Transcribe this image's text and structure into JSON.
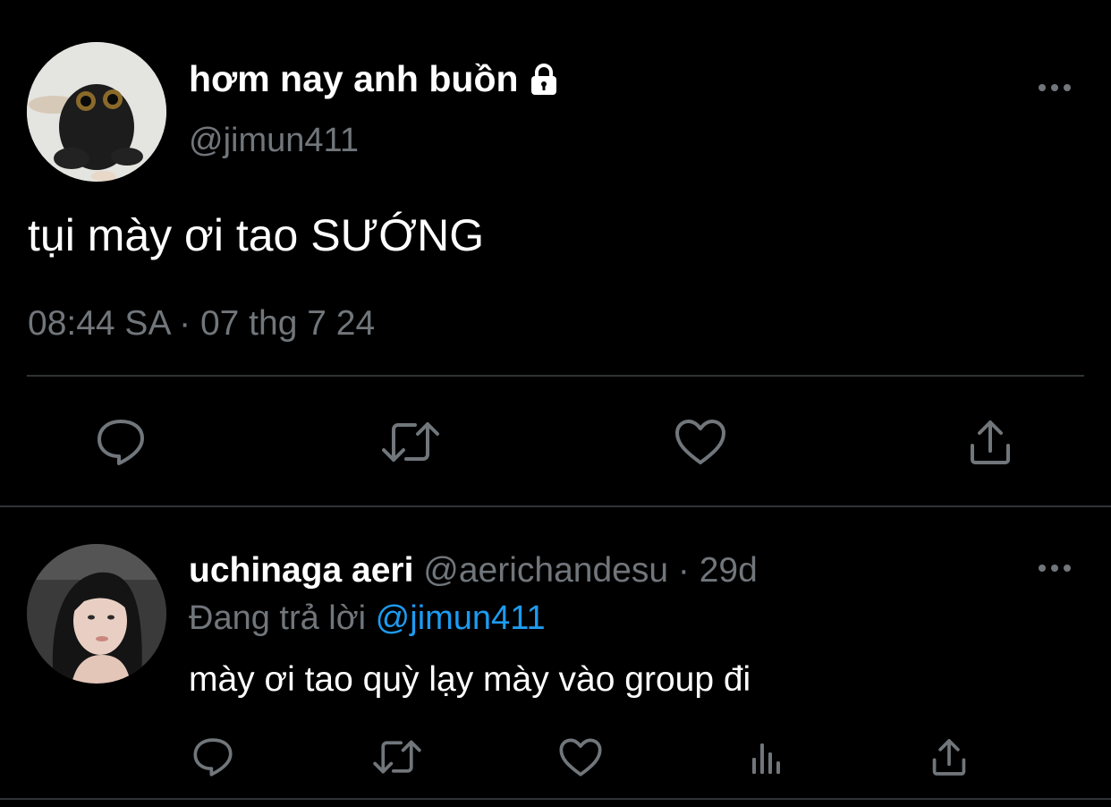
{
  "main_tweet": {
    "display_name": "hơm nay anh buồn",
    "handle": "@jimun411",
    "text": "tụi mày ơi tao SƯỚNG",
    "timestamp": "08:44 SA · 07 thg 7 24",
    "icons": {
      "more": "more-icon",
      "lock": "lock-icon",
      "reply": "reply-icon",
      "retweet": "retweet-icon",
      "like": "heart-icon",
      "share": "share-icon"
    }
  },
  "reply_tweet": {
    "display_name": "uchinaga aeri",
    "handle": "@aerichandesu",
    "separator": "·",
    "age": "29d",
    "replying_to_label": "Đang trả lời",
    "replying_to_handle": "@jimun411",
    "text": "mày ơi tao quỳ lạy mày vào group đi",
    "icons": {
      "more": "more-icon",
      "reply": "reply-icon",
      "retweet": "retweet-icon",
      "like": "heart-icon",
      "views": "analytics-icon",
      "share": "share-icon"
    }
  },
  "colors": {
    "background": "#000000",
    "primary_text": "#ffffff",
    "secondary_text": "#71767b",
    "accent": "#1d9bf0",
    "divider": "#2f3336"
  }
}
